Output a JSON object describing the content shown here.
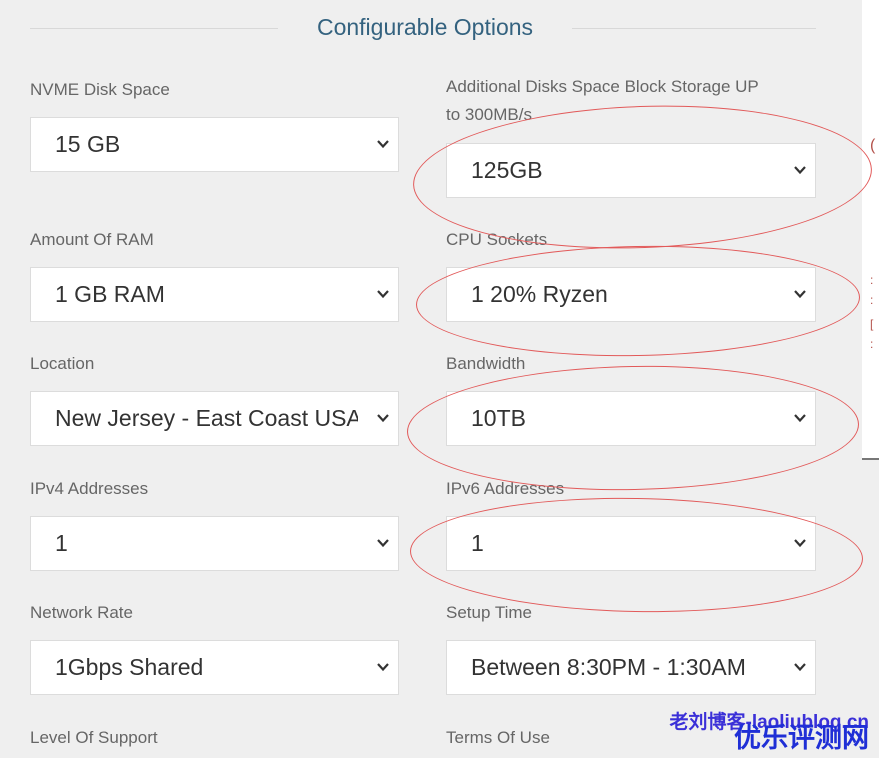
{
  "section": {
    "title": "Configurable Options"
  },
  "fields": {
    "nvme_disk": {
      "label": "NVME Disk Space",
      "value": "15 GB"
    },
    "additional_disks": {
      "label_line1": "Additional Disks Space Block Storage UP",
      "label_line2": "to 300MB/s",
      "value": "125GB"
    },
    "ram": {
      "label": "Amount Of RAM",
      "value": "1 GB RAM"
    },
    "cpu_sockets": {
      "label": "CPU Sockets",
      "value": "1 20% Ryzen"
    },
    "location": {
      "label": "Location",
      "value": "New Jersey - East Coast USA"
    },
    "bandwidth": {
      "label": "Bandwidth",
      "value": "10TB"
    },
    "ipv4": {
      "label": "IPv4 Addresses",
      "value": "1"
    },
    "ipv6": {
      "label": "IPv6 Addresses",
      "value": "1"
    },
    "network_rate": {
      "label": "Network Rate",
      "value": "1Gbps Shared"
    },
    "setup_time": {
      "label": "Setup Time",
      "value": "Between 8:30PM - 1:30AM"
    },
    "level_of_support": {
      "label": "Level Of Support"
    },
    "terms_of_use": {
      "label": "Terms Of Use"
    }
  },
  "watermark": {
    "line1": "老刘博客-laoliublog.cn",
    "line2": "优乐评测网"
  },
  "colors": {
    "accent_title": "#34627f",
    "annotation": "#e25a5a",
    "watermark1": "#3b30d8",
    "watermark2": "#1f2fd6"
  },
  "icons": {
    "select_arrow": "chevron-down-icon"
  }
}
